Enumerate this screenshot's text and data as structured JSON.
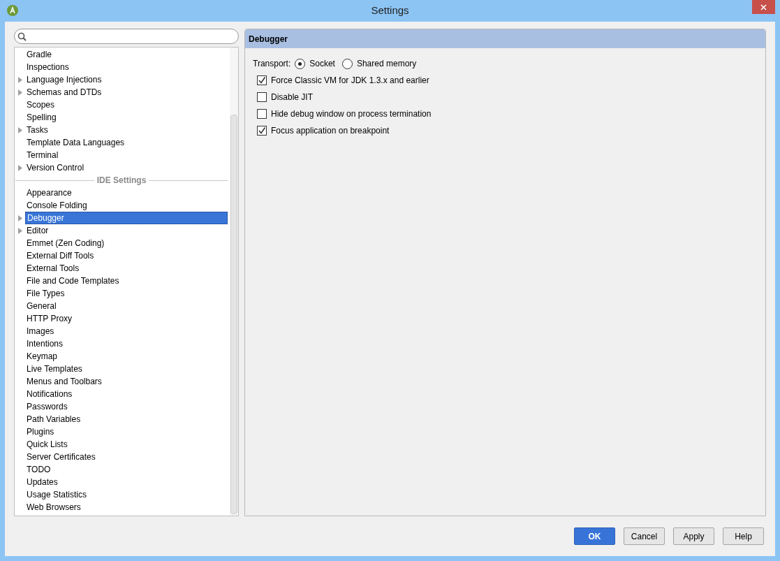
{
  "window": {
    "title": "Settings"
  },
  "tree": [
    {
      "kind": "item",
      "label": "Gradle",
      "expandable": false,
      "selected": false
    },
    {
      "kind": "item",
      "label": "Inspections",
      "expandable": false,
      "selected": false
    },
    {
      "kind": "item",
      "label": "Language Injections",
      "expandable": true,
      "selected": false
    },
    {
      "kind": "item",
      "label": "Schemas and DTDs",
      "expandable": true,
      "selected": false
    },
    {
      "kind": "item",
      "label": "Scopes",
      "expandable": false,
      "selected": false
    },
    {
      "kind": "item",
      "label": "Spelling",
      "expandable": false,
      "selected": false
    },
    {
      "kind": "item",
      "label": "Tasks",
      "expandable": true,
      "selected": false
    },
    {
      "kind": "item",
      "label": "Template Data Languages",
      "expandable": false,
      "selected": false
    },
    {
      "kind": "item",
      "label": "Terminal",
      "expandable": false,
      "selected": false
    },
    {
      "kind": "item",
      "label": "Version Control",
      "expandable": true,
      "selected": false
    },
    {
      "kind": "separator",
      "label": "IDE Settings"
    },
    {
      "kind": "item",
      "label": "Appearance",
      "expandable": false,
      "selected": false
    },
    {
      "kind": "item",
      "label": "Console Folding",
      "expandable": false,
      "selected": false
    },
    {
      "kind": "item",
      "label": "Debugger",
      "expandable": true,
      "selected": true
    },
    {
      "kind": "item",
      "label": "Editor",
      "expandable": true,
      "selected": false
    },
    {
      "kind": "item",
      "label": "Emmet (Zen Coding)",
      "expandable": false,
      "selected": false
    },
    {
      "kind": "item",
      "label": "External Diff Tools",
      "expandable": false,
      "selected": false
    },
    {
      "kind": "item",
      "label": "External Tools",
      "expandable": false,
      "selected": false
    },
    {
      "kind": "item",
      "label": "File and Code Templates",
      "expandable": false,
      "selected": false
    },
    {
      "kind": "item",
      "label": "File Types",
      "expandable": false,
      "selected": false
    },
    {
      "kind": "item",
      "label": "General",
      "expandable": false,
      "selected": false
    },
    {
      "kind": "item",
      "label": "HTTP Proxy",
      "expandable": false,
      "selected": false
    },
    {
      "kind": "item",
      "label": "Images",
      "expandable": false,
      "selected": false
    },
    {
      "kind": "item",
      "label": "Intentions",
      "expandable": false,
      "selected": false
    },
    {
      "kind": "item",
      "label": "Keymap",
      "expandable": false,
      "selected": false
    },
    {
      "kind": "item",
      "label": "Live Templates",
      "expandable": false,
      "selected": false
    },
    {
      "kind": "item",
      "label": "Menus and Toolbars",
      "expandable": false,
      "selected": false
    },
    {
      "kind": "item",
      "label": "Notifications",
      "expandable": false,
      "selected": false
    },
    {
      "kind": "item",
      "label": "Passwords",
      "expandable": false,
      "selected": false
    },
    {
      "kind": "item",
      "label": "Path Variables",
      "expandable": false,
      "selected": false
    },
    {
      "kind": "item",
      "label": "Plugins",
      "expandable": false,
      "selected": false
    },
    {
      "kind": "item",
      "label": "Quick Lists",
      "expandable": false,
      "selected": false
    },
    {
      "kind": "item",
      "label": "Server Certificates",
      "expandable": false,
      "selected": false
    },
    {
      "kind": "item",
      "label": "TODO",
      "expandable": false,
      "selected": false
    },
    {
      "kind": "item",
      "label": "Updates",
      "expandable": false,
      "selected": false
    },
    {
      "kind": "item",
      "label": "Usage Statistics",
      "expandable": false,
      "selected": false
    },
    {
      "kind": "item",
      "label": "Web Browsers",
      "expandable": false,
      "selected": false
    }
  ],
  "panel": {
    "title": "Debugger",
    "transport": {
      "label": "Transport:",
      "options": [
        {
          "label": "Socket",
          "selected": true
        },
        {
          "label": "Shared memory",
          "selected": false
        }
      ]
    },
    "options": [
      {
        "label": "Force Classic VM for JDK 1.3.x and earlier",
        "checked": true
      },
      {
        "label": "Disable JIT",
        "checked": false
      },
      {
        "label": "Hide debug window on process termination",
        "checked": false
      },
      {
        "label": "Focus application on breakpoint",
        "checked": true
      }
    ]
  },
  "buttons": [
    {
      "label": "OK",
      "kind": "primary"
    },
    {
      "label": "Cancel",
      "kind": "normal"
    },
    {
      "label": "Apply",
      "kind": "normal"
    },
    {
      "label": "Help",
      "kind": "normal"
    }
  ]
}
